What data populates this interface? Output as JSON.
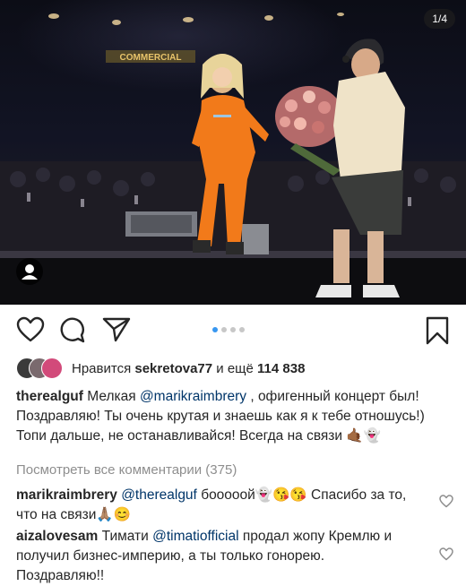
{
  "post": {
    "counter": "1/4",
    "billboard_text": "COMMERCIAL"
  },
  "likes": {
    "label": "Нравится",
    "user": "sekretova77",
    "connector": "и ещё",
    "count": "114 838"
  },
  "caption": {
    "user": "therealguf",
    "text1": "Мелкая",
    "mention": "@marikraimbrery",
    "text2": ", офигенный концерт был! Поздравляю! Ты очень крутая и знаешь как я к тебе отношусь!) Топи дальше, не останавливайся! Всегда на связи 🤙🏾👻"
  },
  "view_all_comments": "Посмотреть все комментарии (375)",
  "comments": [
    {
      "user": "marikraimbrery",
      "mention": "@therealguf",
      "text": "бооооой👻😘😘 Спасибо за то, что на связи🙏🏽😊"
    },
    {
      "user": "aizalovesam",
      "text1": "Тимати",
      "mention": "@timatiofficial",
      "text2": "продал жопу Кремлю и получил бизнес-империю, а ты только гонорею. Поздравляю!!"
    }
  ],
  "icons": [
    "heart-icon",
    "comment-icon",
    "share-icon",
    "bookmark-icon",
    "user-tag-icon"
  ],
  "colors": {
    "accent_blue": "#3897f0",
    "mention": "#003569",
    "muted": "#8e8e8e",
    "jumpsuit_orange": "#f27a1a"
  }
}
